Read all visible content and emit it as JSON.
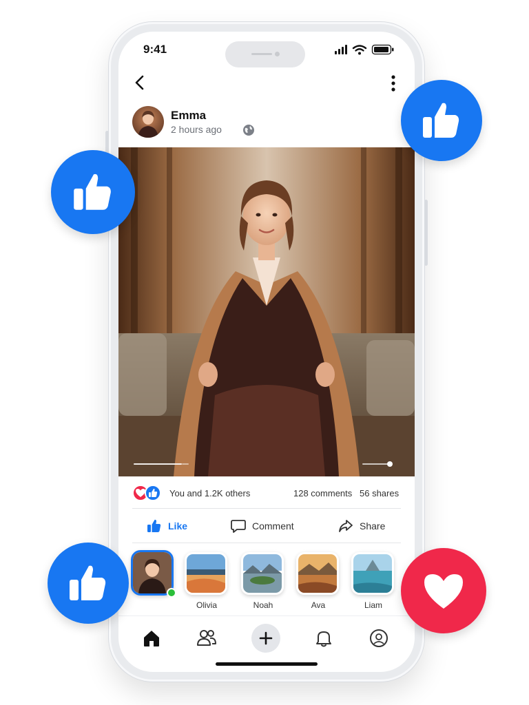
{
  "status_bar": {
    "time": "9:41"
  },
  "post": {
    "author": "Emma",
    "timestamp": "2 hours ago",
    "privacy_icon": "globe-icon"
  },
  "stats": {
    "reactions_text": "You and 1.2K others",
    "comments": "128 comments",
    "shares": "56 shares"
  },
  "actions": {
    "like": "Like",
    "comment": "Comment",
    "share": "Share"
  },
  "stories": [
    {
      "label": ""
    },
    {
      "label": "Olivia"
    },
    {
      "label": "Noah"
    },
    {
      "label": "Ava"
    },
    {
      "label": "Liam"
    }
  ],
  "bottom_nav": [
    "home-icon",
    "friends-icon",
    "create-icon",
    "notifications-icon",
    "profile-icon"
  ],
  "colors": {
    "brand": "#1877f2",
    "heart": "#f0284a",
    "online": "#2bbf3a"
  }
}
